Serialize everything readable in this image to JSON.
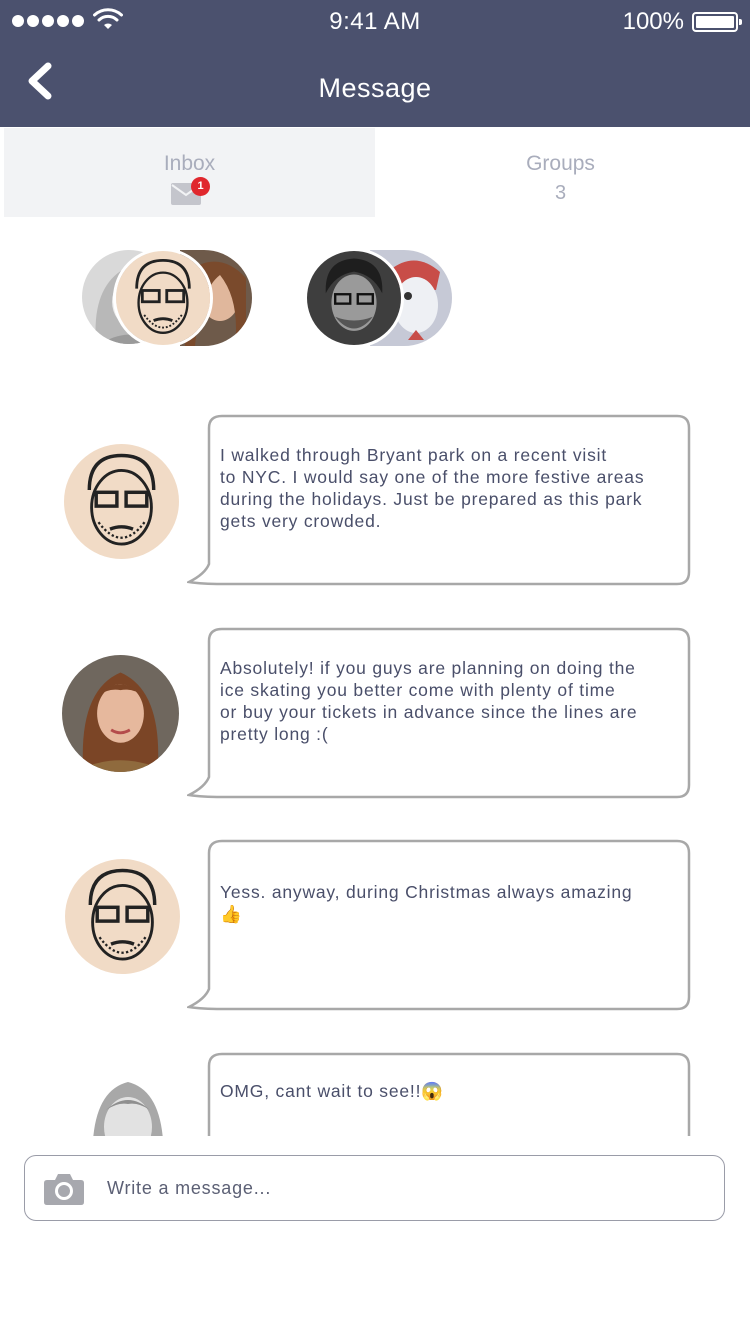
{
  "status_bar": {
    "time": "9:41 AM",
    "battery": "100%"
  },
  "header": {
    "title": "Message",
    "back_icon": "chevron-left-icon"
  },
  "tabs": [
    {
      "label": "Inbox",
      "icon": "envelope-icon",
      "badge": "1",
      "active": true
    },
    {
      "label": "Groups",
      "count": "3",
      "active": false
    }
  ],
  "groups": [
    {
      "members": [
        "blonde-woman",
        "cartoon-man",
        "brunette-woman"
      ]
    },
    {
      "members": [
        "bearded-man",
        "illustrated-man"
      ]
    }
  ],
  "messages": [
    {
      "avatar": "cartoon-man",
      "text": "I walked through Bryant park on a recent visit\nto NYC. I would say one of the more festive areas\nduring the holidays. Just be prepared as this park\ngets very crowded."
    },
    {
      "avatar": "brunette-woman",
      "text": "Absolutely! if you guys are planning on doing the\nice skating you better come with plenty of time\nor buy your tickets in advance since the lines are\npretty long :("
    },
    {
      "avatar": "cartoon-man",
      "text": "Yess. anyway, during Christmas always amazing\n👍"
    },
    {
      "avatar": "blonde-woman",
      "text": "OMG, cant wait to see!!😱"
    }
  ],
  "composer": {
    "placeholder": "Write a message...",
    "value": "",
    "icon": "camera-icon"
  },
  "colors": {
    "header": "#4b516e",
    "badge": "#e0272d",
    "bubble_border": "#a8a8a8"
  }
}
